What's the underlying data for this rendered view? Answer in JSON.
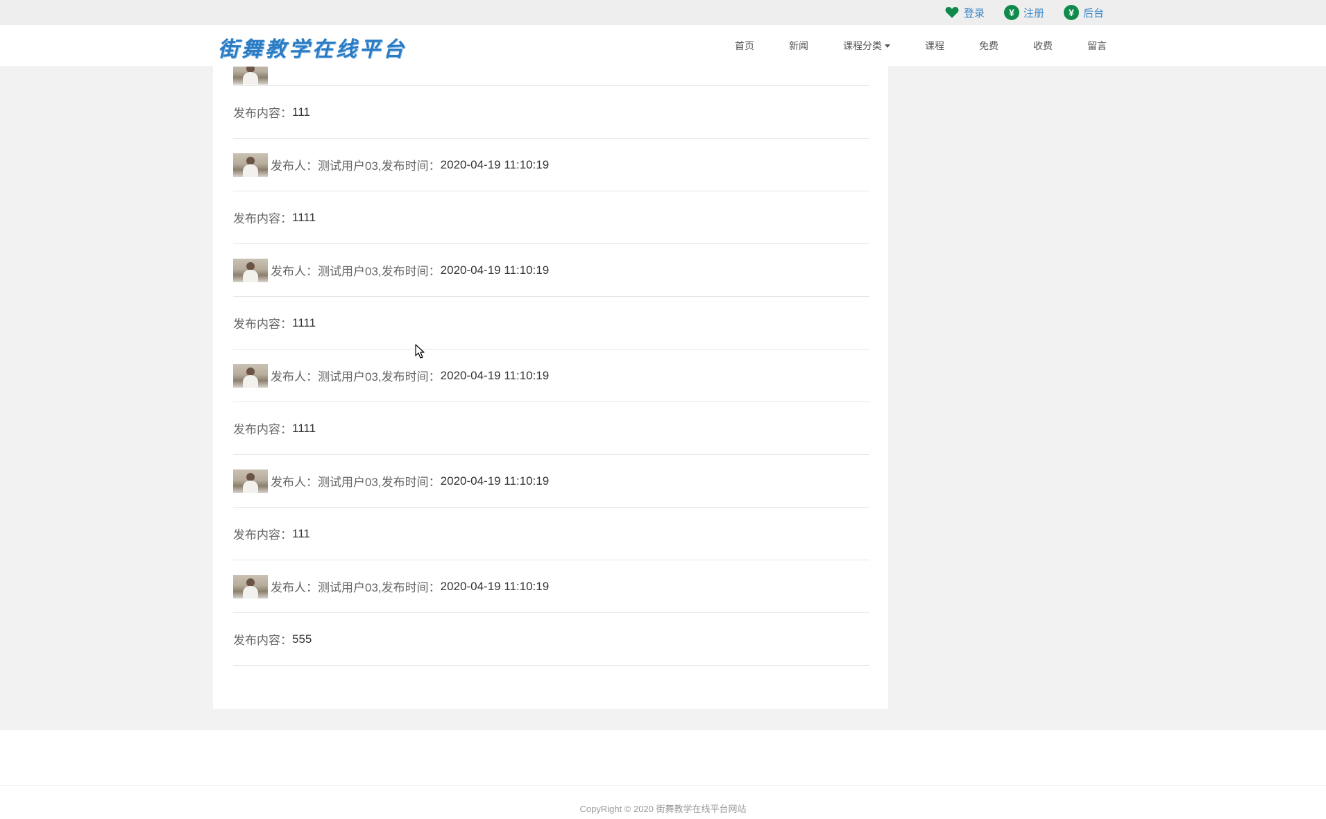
{
  "topbar": {
    "links": [
      {
        "label": "登录",
        "icon": "heart-icon"
      },
      {
        "label": "注册",
        "icon": "yen-icon"
      },
      {
        "label": "后台",
        "icon": "yen-icon"
      }
    ],
    "yen_glyph": "¥",
    "link_color": "#3a88c8",
    "icon_color": "#0f8a4a"
  },
  "navbar": {
    "logo": "街舞教学在线平台",
    "items": [
      "首页",
      "新闻",
      "课程分类",
      "课程",
      "免费",
      "收费",
      "留言"
    ]
  },
  "messages": [
    {
      "publisher_label": "发布人：",
      "publisher": "测试用户03",
      "time_label": ",发布时间：",
      "time": "2020-04-19 11:10:19",
      "content_label": "发布内容：",
      "content": "1111"
    },
    {
      "publisher_label": "发布人：",
      "publisher": "测试用户03",
      "time_label": ",发布时间：",
      "time": "2020-04-19 11:10:19",
      "content_label": "发布内容：",
      "content": "1111"
    },
    {
      "publisher_label": "发布人：",
      "publisher": "测试用户03",
      "time_label": ",发布时间：",
      "time": "2020-04-19 11:10:19",
      "content_label": "发布内容：",
      "content": "1111"
    },
    {
      "publisher_label": "发布人：",
      "publisher": "测试用户03",
      "time_label": ",发布时间：",
      "time": "2020-04-19 11:10:19",
      "content_label": "发布内容：",
      "content": "111"
    },
    {
      "publisher_label": "发布人：",
      "publisher": "测试用户03",
      "time_label": ",发布时间：",
      "time": "2020-04-19 11:10:19",
      "content_label": "发布内容：",
      "content": "555"
    }
  ],
  "first_content": {
    "label": "发布内容：",
    "value": "111"
  },
  "footer": {
    "copyright": "CopyRight © 2020 街舞教学在线平台网站"
  }
}
